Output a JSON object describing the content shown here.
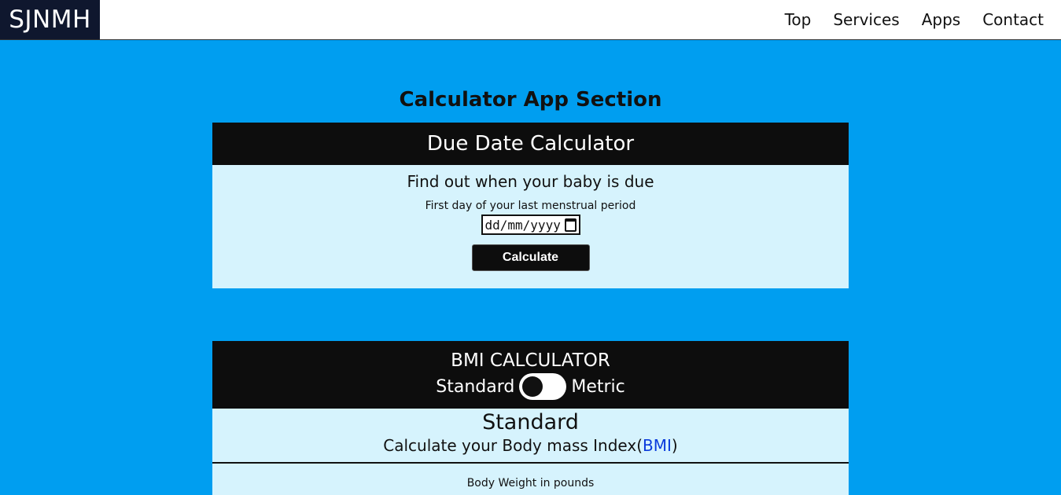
{
  "logo": "SJNMH",
  "nav": {
    "top": "Top",
    "services": "Services",
    "apps": "Apps",
    "contact": "Contact"
  },
  "section_title": "Calculator App Section",
  "due_date": {
    "title": "Due Date Calculator",
    "subtitle": "Find out when your baby is due",
    "label": "First day of your last menstrual period",
    "placeholder": "dd/mm/yyyy",
    "button": "Calculate"
  },
  "bmi": {
    "title": "BMI CALCULATOR",
    "toggle_left": "Standard",
    "toggle_right": "Metric",
    "mode": "Standard",
    "subtitle_prefix": "Calculate your Body mass Index(",
    "subtitle_link": "BMI",
    "subtitle_suffix": ")",
    "weight_label": "Body Weight in pounds"
  }
}
